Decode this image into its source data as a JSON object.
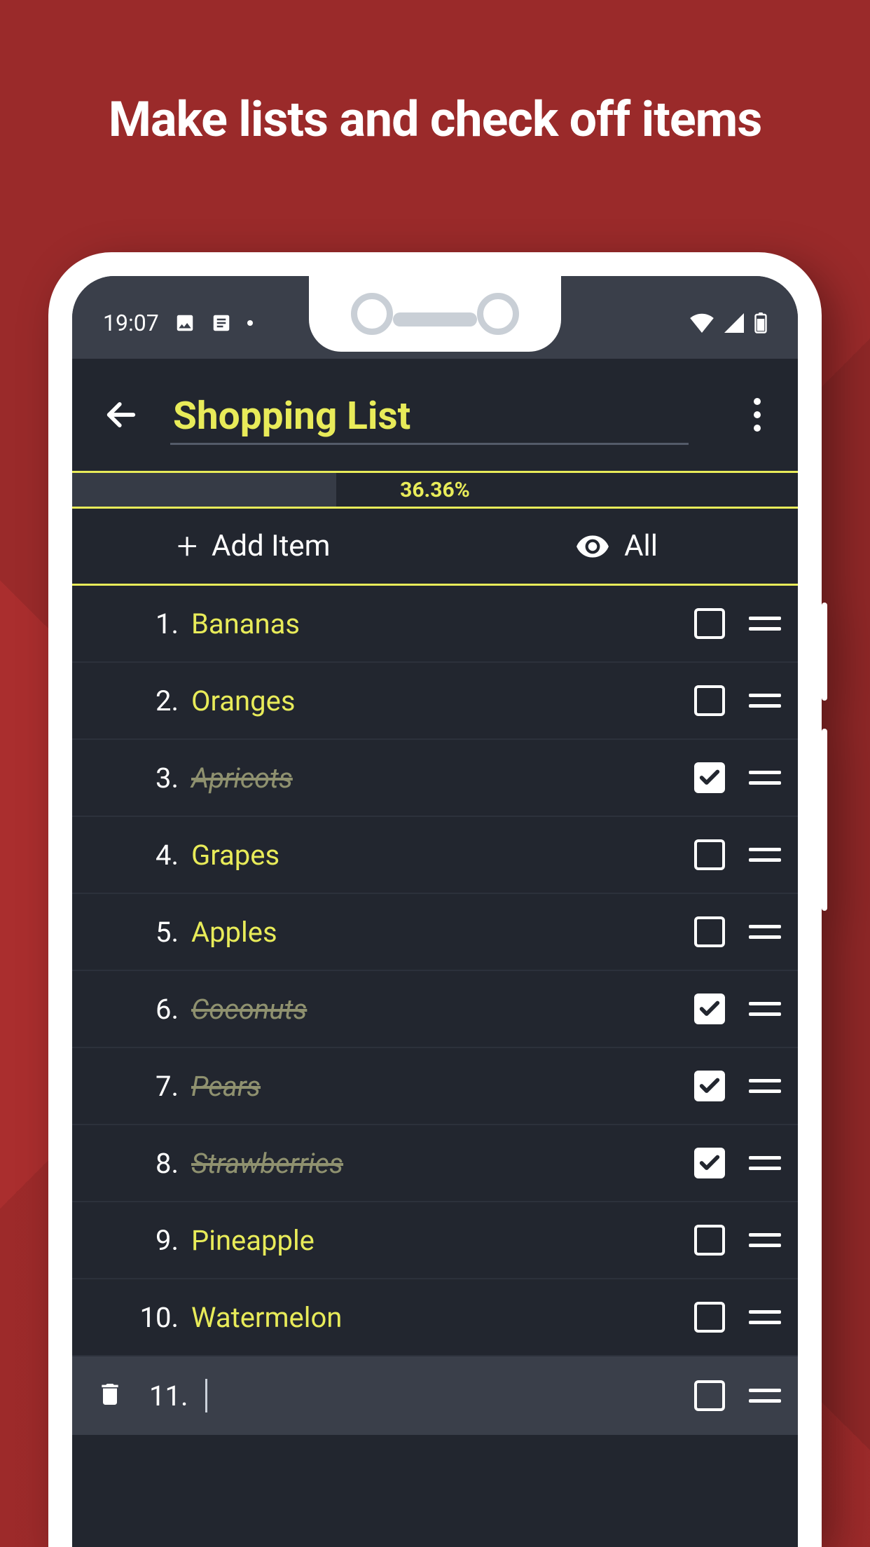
{
  "promo": {
    "headline": "Make lists and check off items"
  },
  "status": {
    "time": "19:07"
  },
  "header": {
    "title": "Shopping List"
  },
  "progress": {
    "percent": 36.36,
    "label": "36.36%"
  },
  "actions": {
    "add": "Add Item",
    "filter": "All"
  },
  "items": [
    {
      "n": "1.",
      "label": "Bananas",
      "done": false
    },
    {
      "n": "2.",
      "label": "Oranges",
      "done": false
    },
    {
      "n": "3.",
      "label": "Apricots",
      "done": true
    },
    {
      "n": "4.",
      "label": "Grapes",
      "done": false
    },
    {
      "n": "5.",
      "label": "Apples",
      "done": false
    },
    {
      "n": "6.",
      "label": "Coconuts",
      "done": true
    },
    {
      "n": "7.",
      "label": "Pears",
      "done": true
    },
    {
      "n": "8.",
      "label": "Strawberries",
      "done": true
    },
    {
      "n": "9.",
      "label": "Pineapple",
      "done": false
    },
    {
      "n": "10.",
      "label": "Watermelon",
      "done": false
    }
  ],
  "newItem": {
    "n": "11."
  }
}
